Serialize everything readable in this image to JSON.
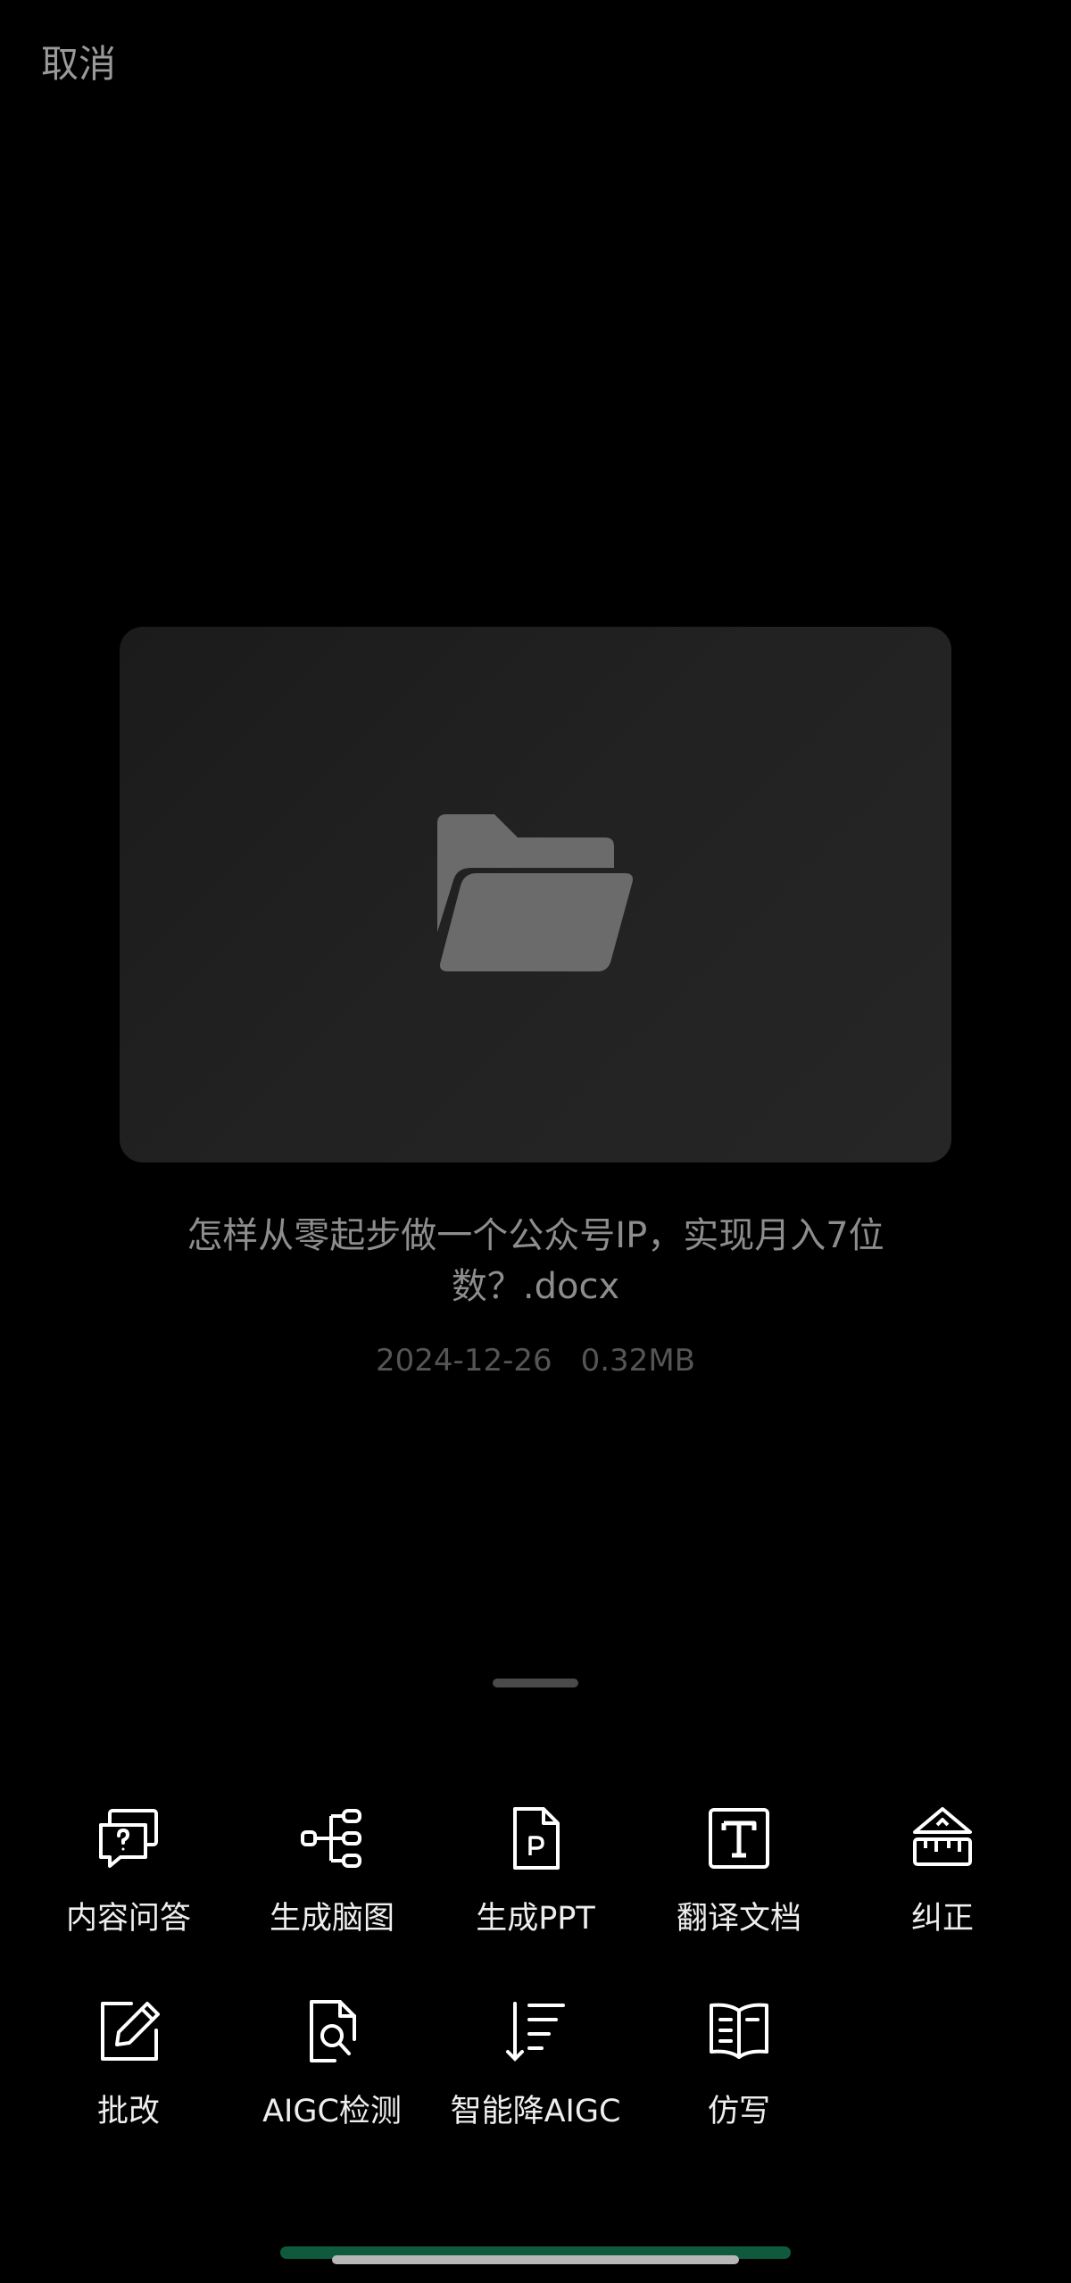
{
  "header": {
    "cancel_label": "取消"
  },
  "file": {
    "icon": "folder-open-icon",
    "name": "怎样从零起步做一个公众号IP，实现月入7位数？.docx",
    "date": "2024-12-26",
    "size": "0.32MB"
  },
  "actions": [
    {
      "label": "内容问答",
      "icon": "question-answer-icon"
    },
    {
      "label": "生成脑图",
      "icon": "mind-map-icon"
    },
    {
      "label": "生成PPT",
      "icon": "ppt-file-icon"
    },
    {
      "label": "翻译文档",
      "icon": "text-box-icon"
    },
    {
      "label": "纠正",
      "icon": "ruler-correct-icon"
    },
    {
      "label": "批改",
      "icon": "edit-pen-icon"
    },
    {
      "label": "AIGC检测",
      "icon": "document-search-icon"
    },
    {
      "label": "智能降AIGC",
      "icon": "sort-reduce-icon"
    },
    {
      "label": "仿写",
      "icon": "open-book-icon"
    }
  ],
  "colors": {
    "background": "#000000",
    "card": "#222222",
    "accent": "#0f5a3c"
  }
}
